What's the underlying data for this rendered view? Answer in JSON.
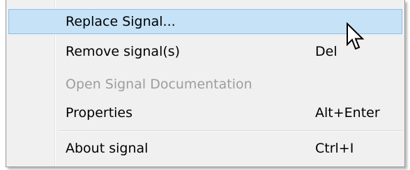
{
  "menu": {
    "items": [
      {
        "label": "Replace Signal...",
        "shortcut": ""
      },
      {
        "label": "Remove signal(s)",
        "shortcut": "Del"
      },
      {
        "label": "Open Signal Documentation",
        "shortcut": ""
      },
      {
        "label": "Properties",
        "shortcut": "Alt+Enter"
      },
      {
        "label": "About signal",
        "shortcut": "Ctrl+I"
      }
    ]
  },
  "colors": {
    "highlight_fill": "#c5e2f7",
    "highlight_border": "#8ec0e8",
    "menu_background": "#f0f0f0",
    "disabled_text": "#9d9d9d"
  },
  "cursor_icon": "arrow-pointer-icon"
}
